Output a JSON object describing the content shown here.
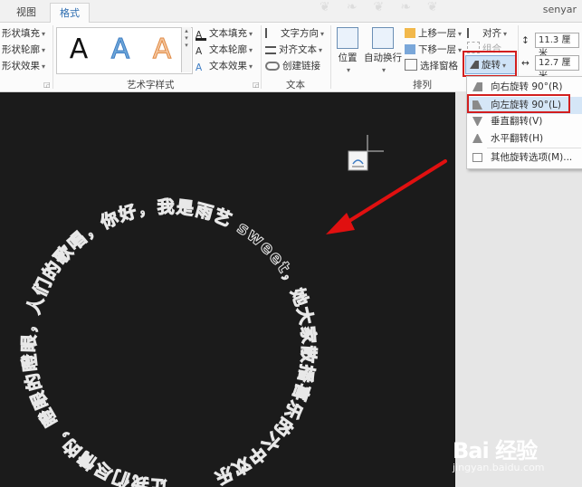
{
  "tabs": {
    "view": "视图",
    "format": "格式"
  },
  "user": "senyar",
  "shape_styles": {
    "fill": "形状填充",
    "outline": "形状轮廓",
    "effects": "形状效果"
  },
  "wordart": {
    "group_label": "艺术字样式",
    "samples": [
      "A",
      "A",
      "A"
    ],
    "text_fill": "文本填充",
    "text_outline": "文本轮廓",
    "text_effects": "文本效果"
  },
  "text_group": {
    "label": "文本",
    "direction": "文字方向",
    "align": "对齐文本",
    "link": "创建链接"
  },
  "arrange": {
    "label": "排列",
    "position": "位置",
    "wrap": "自动换行",
    "bring_forward": "上移一层",
    "send_backward": "下移一层",
    "selection_pane": "选择窗格",
    "align": "对齐",
    "group": "组合",
    "rotate": "旋转"
  },
  "size": {
    "height": "11.3 厘米",
    "width": "12.7 厘米"
  },
  "rotate_menu": {
    "items": [
      "向右旋转 90°(R)",
      "向左旋转 90°(L)",
      "垂直翻转(V)",
      "水平翻转(H)"
    ],
    "more": "其他旋转选项(M)..."
  },
  "circle_text": "让我们尽情的，瞪眼的瞪眼，人们的歌唱，你好，我是雨艺 sweet，她大家散播喜乐的六中欢乐",
  "watermark": {
    "logo": "Bai 经验",
    "url": "jingyan.baidu.com"
  },
  "colors": {
    "accent": "#2b6cb0",
    "highlight_box": "#d21f1f",
    "arrow": "#e01010",
    "canvas": "#1b1b1b"
  }
}
